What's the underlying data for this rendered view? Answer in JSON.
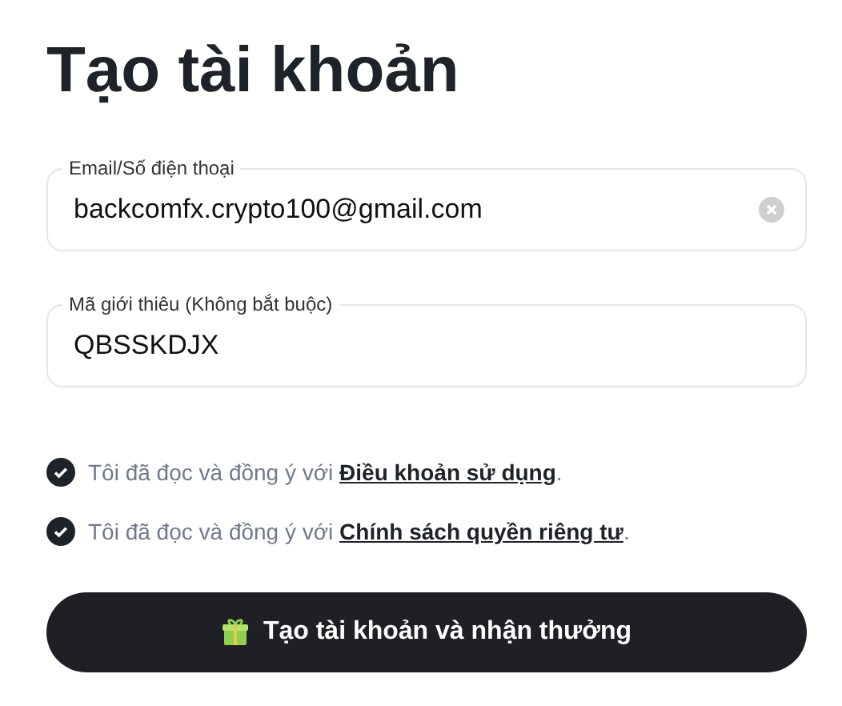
{
  "title": "Tạo tài khoản",
  "fields": [
    {
      "label": "Email/Số điện thoại",
      "value": "backcomfx.crypto100@gmail.com",
      "clearable": true
    },
    {
      "label": "Mã giới thiêu (Không bắt buộc)",
      "value": "QBSSKDJX",
      "clearable": false
    }
  ],
  "agreements": [
    {
      "text": "Tôi đã đọc và đồng ý với ",
      "link": "Điều khoản sử dụng",
      "end": ".",
      "checked": true
    },
    {
      "text": "Tôi đã đọc và đồng ý với ",
      "link": "Chính sách quyền riêng tư",
      "end": ".",
      "checked": true
    }
  ],
  "submit_button": {
    "label": "Tạo tài khoản và nhận thưởng"
  }
}
